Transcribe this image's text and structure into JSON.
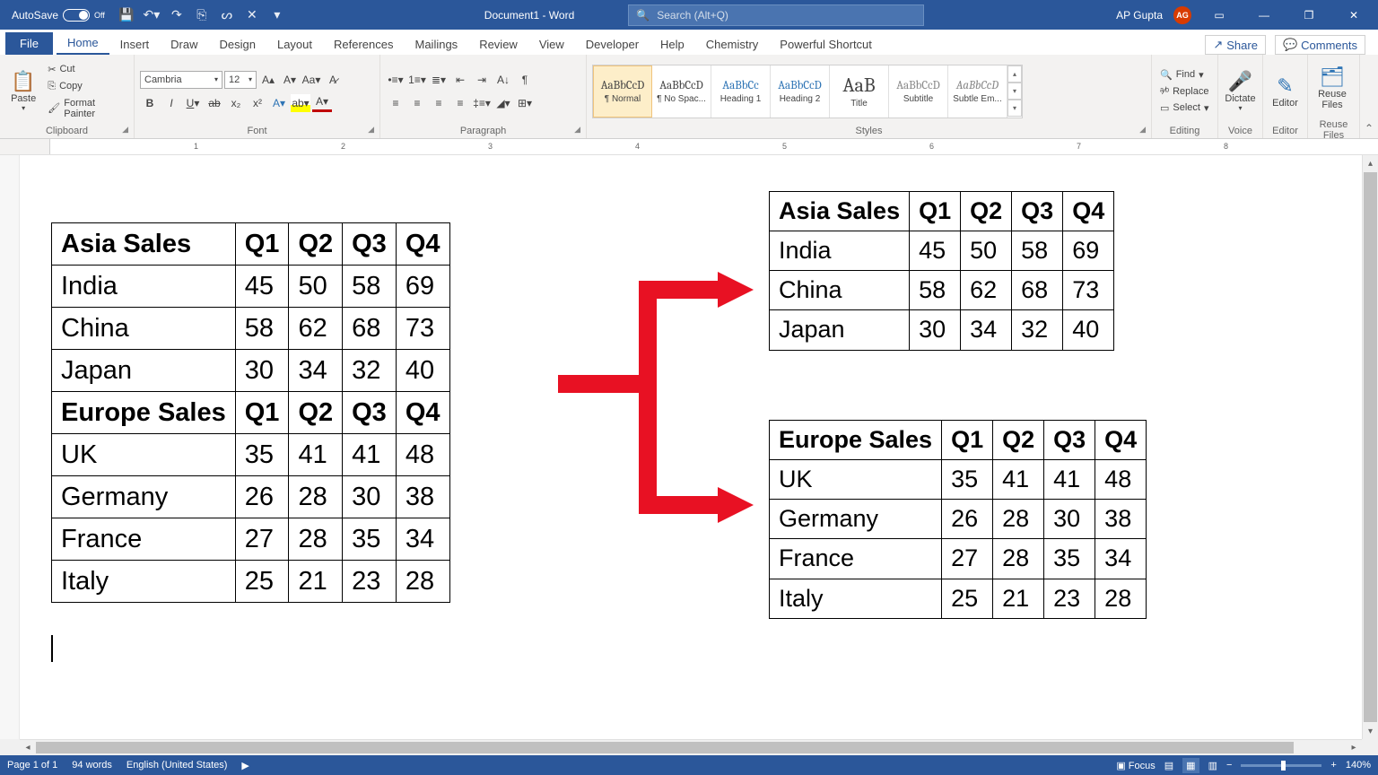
{
  "title": {
    "autosave_label": "AutoSave",
    "autosave_state": "Off",
    "document": "Document1  -  Word",
    "search_placeholder": "Search (Alt+Q)",
    "user_name": "AP Gupta",
    "user_initials": "AG"
  },
  "tabs": {
    "file": "File",
    "home": "Home",
    "insert": "Insert",
    "draw": "Draw",
    "design": "Design",
    "layout": "Layout",
    "references": "References",
    "mailings": "Mailings",
    "review": "Review",
    "view": "View",
    "developer": "Developer",
    "help": "Help",
    "chemistry": "Chemistry",
    "shortcut": "Powerful Shortcut",
    "share": "Share",
    "comments": "Comments"
  },
  "ribbon": {
    "clipboard": {
      "label": "Clipboard",
      "paste": "Paste",
      "cut": "Cut",
      "copy": "Copy",
      "format_painter": "Format Painter"
    },
    "font": {
      "label": "Font",
      "name": "Cambria",
      "size": "12"
    },
    "paragraph": {
      "label": "Paragraph"
    },
    "styles": {
      "label": "Styles",
      "items": [
        {
          "preview": "AaBbCcD",
          "label": "¶ Normal"
        },
        {
          "preview": "AaBbCcD",
          "label": "¶ No Spac..."
        },
        {
          "preview": "AaBbCc",
          "label": "Heading 1"
        },
        {
          "preview": "AaBbCcD",
          "label": "Heading 2"
        },
        {
          "preview": "AaB",
          "label": "Title"
        },
        {
          "preview": "AaBbCcD",
          "label": "Subtitle"
        },
        {
          "preview": "AaBbCcD",
          "label": "Subtle Em..."
        }
      ]
    },
    "editing": {
      "label": "Editing",
      "find": "Find",
      "replace": "Replace",
      "select": "Select"
    },
    "dictate": "Dictate",
    "editor": "Editor",
    "reuse": "Reuse Files",
    "voice": "Voice",
    "editor_grp": "Editor",
    "reuse_grp": "Reuse Files"
  },
  "ruler_marks": [
    "1",
    "2",
    "3",
    "4",
    "5",
    "6",
    "7",
    "8"
  ],
  "chart_data": [
    {
      "type": "table",
      "title": "Asia Sales",
      "columns": [
        "Q1",
        "Q2",
        "Q3",
        "Q4"
      ],
      "rows": [
        {
          "name": "India",
          "values": [
            45,
            50,
            58,
            69
          ]
        },
        {
          "name": "China",
          "values": [
            58,
            62,
            68,
            73
          ]
        },
        {
          "name": "Japan",
          "values": [
            30,
            34,
            32,
            40
          ]
        }
      ]
    },
    {
      "type": "table",
      "title": "Europe Sales",
      "columns": [
        "Q1",
        "Q2",
        "Q3",
        "Q4"
      ],
      "rows": [
        {
          "name": "UK",
          "values": [
            35,
            41,
            41,
            48
          ]
        },
        {
          "name": "Germany",
          "values": [
            26,
            28,
            30,
            38
          ]
        },
        {
          "name": "France",
          "values": [
            27,
            28,
            35,
            34
          ]
        },
        {
          "name": "Italy",
          "values": [
            25,
            21,
            23,
            28
          ]
        }
      ]
    }
  ],
  "status": {
    "page": "Page 1 of 1",
    "words": "94 words",
    "lang": "English (United States)",
    "focus": "Focus",
    "zoom": "140%"
  }
}
